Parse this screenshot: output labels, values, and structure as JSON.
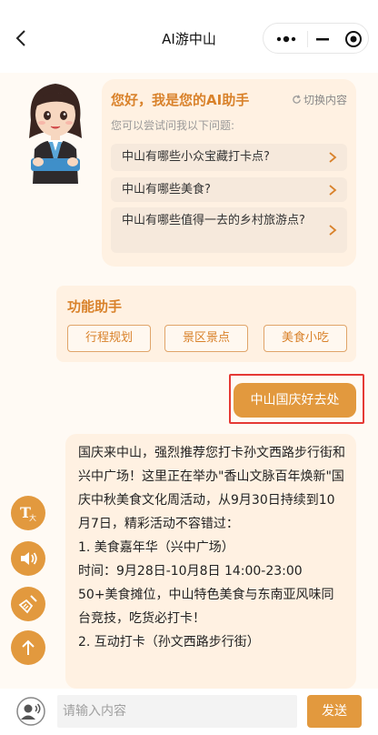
{
  "header": {
    "title": "AI游中山",
    "icons": [
      "back-arrow-icon",
      "more-dots-icon",
      "minimize-icon",
      "close-target-icon"
    ]
  },
  "greeting": {
    "title": "您好，我是您的AI助手",
    "switch_label": "切换内容",
    "switch_icon": "refresh-icon",
    "subtitle": "您可以尝试问我以下问题:",
    "questions": [
      "中山有哪些小众宝藏打卡点?",
      "中山有哪些美食?",
      "中山有哪些值得一去的乡村旅游点?"
    ]
  },
  "functions": {
    "title": "功能助手",
    "buttons": [
      "行程规划",
      "景区景点",
      "美食小吃"
    ]
  },
  "chat": {
    "user_message": "中山国庆好去处",
    "answer": "国庆来中山，强烈推荐您打卡孙文西路步行街和兴中广场！这里正在举办\"香山文脉百年焕新\"国庆中秋美食文化周活动，从9月30日持续到10月7日，精彩活动不容错过：\n1. 美食嘉年华（兴中广场）\n时间：9月28日-10月8日 14:00-23:00\n50+美食摊位，中山特色美食与东南亚风味同台竞技，吃货必打卡！\n2. 互动打卡（孙文西路步行街）"
  },
  "side_buttons": [
    {
      "name": "font-size-icon",
      "glyph": "T",
      "sub": "大"
    },
    {
      "name": "speaker-icon"
    },
    {
      "name": "broom-clear-icon"
    },
    {
      "name": "arrow-up-icon"
    }
  ],
  "input": {
    "placeholder": "请输入内容",
    "send_label": "发送"
  },
  "colors": {
    "accent": "#e2993e",
    "title_orange": "#d9822b",
    "card_bg": "#fff1e2",
    "highlight_border": "#e53935"
  }
}
